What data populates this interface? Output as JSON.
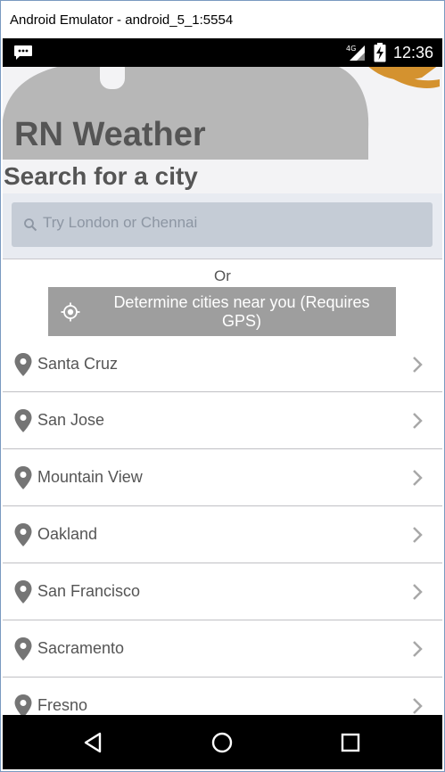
{
  "window": {
    "title": "Android Emulator - android_5_1:5554"
  },
  "status_bar": {
    "time": "12:36",
    "network_label": "4G",
    "icons": [
      "message-icon",
      "signal-icon",
      "battery-charging-icon"
    ]
  },
  "app": {
    "title": "RN Weather",
    "search_heading": "Search for a city",
    "search_placeholder": "Try London or Chennai",
    "or_label": "Or",
    "gps_button_label": "Determine cities near you (Requires GPS)",
    "cities": [
      {
        "name": "Santa Cruz"
      },
      {
        "name": "San Jose"
      },
      {
        "name": "Mountain View"
      },
      {
        "name": "Oakland"
      },
      {
        "name": "San Francisco"
      },
      {
        "name": "Sacramento"
      },
      {
        "name": "Fresno"
      }
    ]
  },
  "nav_bar": {
    "buttons": [
      "back-icon",
      "home-icon",
      "recents-icon"
    ]
  },
  "colors": {
    "header_bg": "#f3f3f5",
    "cloud": "#b7b7b7",
    "sun": "#d4922f",
    "search_box": "#c5ccd6",
    "gps_button": "#9e9e9e",
    "text": "#555555"
  }
}
